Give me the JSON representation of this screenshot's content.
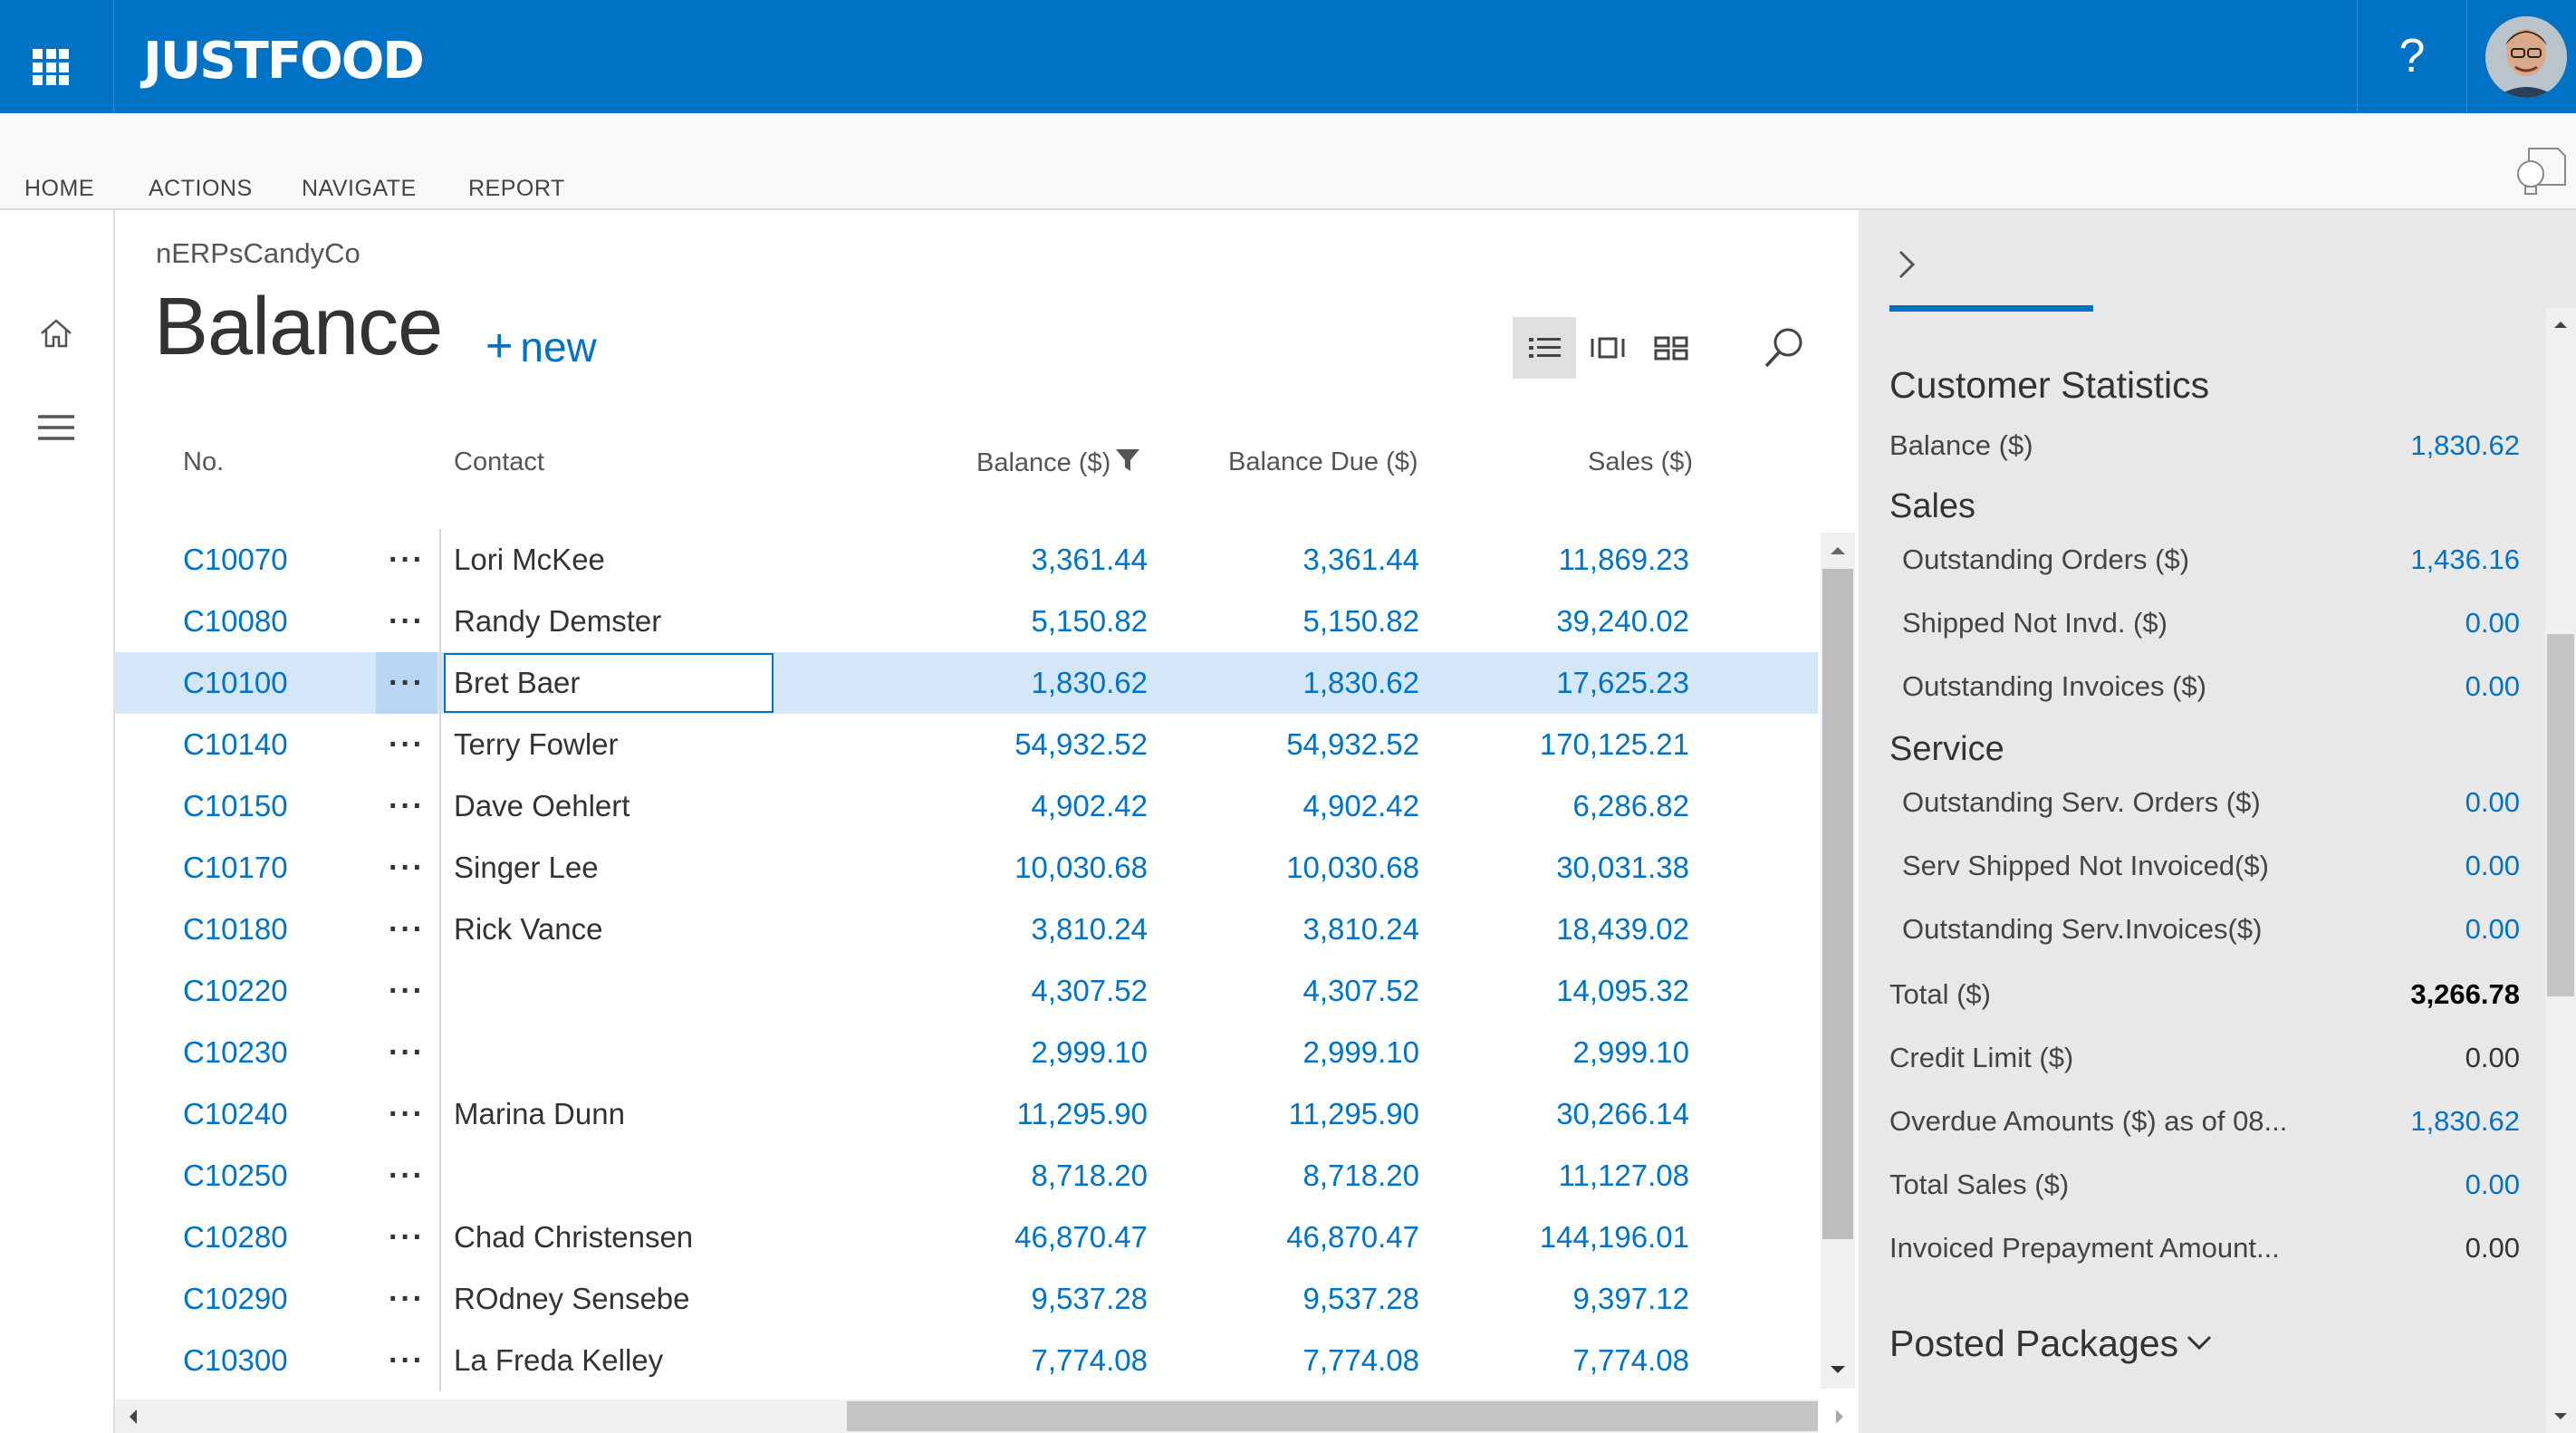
{
  "brand": {
    "name": "JUSTFOOD"
  },
  "topbar": {
    "help_label": "?"
  },
  "ribbon": {
    "tabs": [
      "HOME",
      "ACTIONS",
      "NAVIGATE",
      "REPORT"
    ]
  },
  "page": {
    "company": "nERPsCandyCo",
    "title": "Balance",
    "new_label": "new"
  },
  "columns": {
    "no": "No.",
    "contact": "Contact",
    "balance": "Balance ($)",
    "balance_due": "Balance Due ($)",
    "sales": "Sales ($)"
  },
  "rows": [
    {
      "no": "C10070",
      "contact": "Lori McKee",
      "balance": "3,361.44",
      "balance_due": "3,361.44",
      "sales": "11,869.23"
    },
    {
      "no": "C10080",
      "contact": "Randy Demster",
      "balance": "5,150.82",
      "balance_due": "5,150.82",
      "sales": "39,240.02"
    },
    {
      "no": "C10100",
      "contact": "Bret Baer",
      "balance": "1,830.62",
      "balance_due": "1,830.62",
      "sales": "17,625.23"
    },
    {
      "no": "C10140",
      "contact": "Terry Fowler",
      "balance": "54,932.52",
      "balance_due": "54,932.52",
      "sales": "170,125.21"
    },
    {
      "no": "C10150",
      "contact": "Dave Oehlert",
      "balance": "4,902.42",
      "balance_due": "4,902.42",
      "sales": "6,286.82"
    },
    {
      "no": "C10170",
      "contact": "Singer Lee",
      "balance": "10,030.68",
      "balance_due": "10,030.68",
      "sales": "30,031.38"
    },
    {
      "no": "C10180",
      "contact": "Rick Vance",
      "balance": "3,810.24",
      "balance_due": "3,810.24",
      "sales": "18,439.02"
    },
    {
      "no": "C10220",
      "contact": "",
      "balance": "4,307.52",
      "balance_due": "4,307.52",
      "sales": "14,095.32"
    },
    {
      "no": "C10230",
      "contact": "",
      "balance": "2,999.10",
      "balance_due": "2,999.10",
      "sales": "2,999.10"
    },
    {
      "no": "C10240",
      "contact": "Marina Dunn",
      "balance": "11,295.90",
      "balance_due": "11,295.90",
      "sales": "30,266.14"
    },
    {
      "no": "C10250",
      "contact": "",
      "balance": "8,718.20",
      "balance_due": "8,718.20",
      "sales": "11,127.08"
    },
    {
      "no": "C10280",
      "contact": "Chad Christensen",
      "balance": "46,870.47",
      "balance_due": "46,870.47",
      "sales": "144,196.01"
    },
    {
      "no": "C10290",
      "contact": "ROdney Sensebe",
      "balance": "9,537.28",
      "balance_due": "9,537.28",
      "sales": "9,397.12"
    },
    {
      "no": "C10300",
      "contact": "La Freda Kelley",
      "balance": "7,774.08",
      "balance_due": "7,774.08",
      "sales": "7,774.08"
    }
  ],
  "selected_row": 2,
  "row_menu_label": "···",
  "factbox": {
    "title": "Customer Statistics",
    "balance_label": "Balance ($)",
    "balance_value": "1,830.62",
    "sales_heading": "Sales",
    "sales_items": [
      {
        "label": "Outstanding Orders ($)",
        "value": "1,436.16"
      },
      {
        "label": "Shipped Not Invd. ($)",
        "value": "0.00"
      },
      {
        "label": "Outstanding Invoices ($)",
        "value": "0.00"
      }
    ],
    "service_heading": "Service",
    "service_items": [
      {
        "label": "Outstanding Serv. Orders ($)",
        "value": "0.00"
      },
      {
        "label": "Serv Shipped Not Invoiced($)",
        "value": "0.00"
      },
      {
        "label": "Outstanding Serv.Invoices($)",
        "value": "0.00"
      }
    ],
    "total_label": "Total ($)",
    "total_value": "3,266.78",
    "credit_label": "Credit Limit ($)",
    "credit_value": "0.00",
    "overdue_label": "Overdue Amounts ($) as of 08...",
    "overdue_value": "1,830.62",
    "total_sales_label": "Total Sales ($)",
    "total_sales_value": "0.00",
    "prepay_label": "Invoiced Prepayment Amount...",
    "prepay_value": "0.00",
    "posted_packages": "Posted Packages"
  },
  "colors": {
    "brand_blue": "#0072c6",
    "selected_row": "#d4e7f8",
    "factbox_bg": "#e8e8e8"
  }
}
